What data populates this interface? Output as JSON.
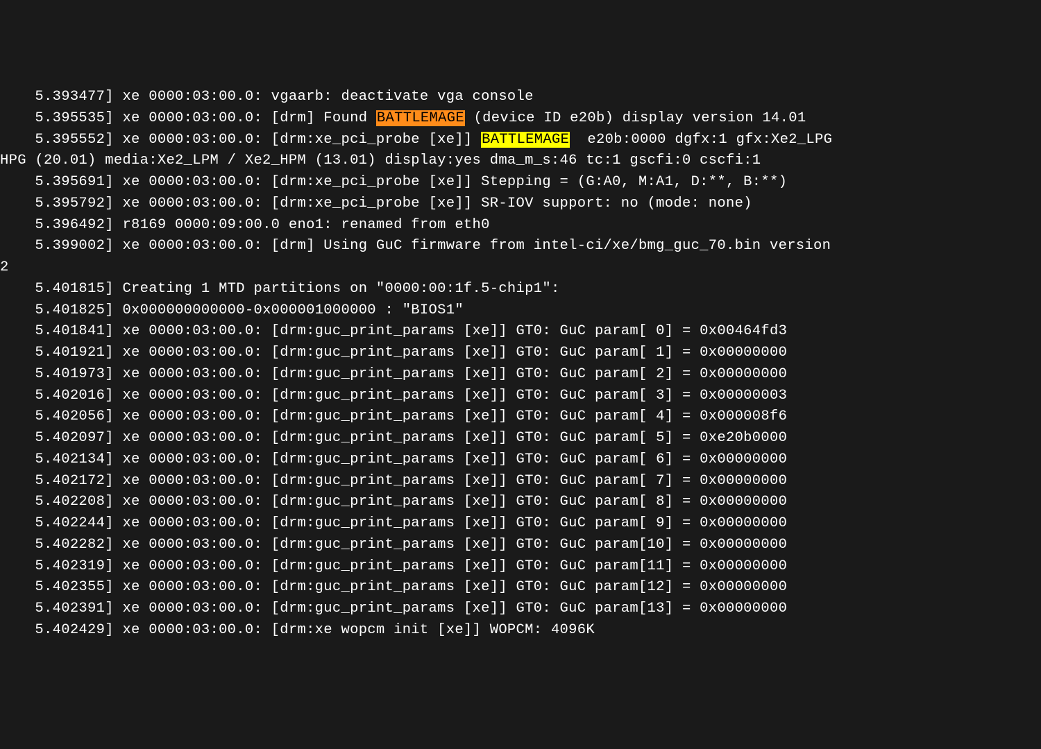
{
  "lines": [
    {
      "type": "text",
      "text": "    5.393477] xe 0000:03:00.0: vgaarb: deactivate vga console"
    },
    {
      "type": "highlighted1",
      "pre": "    5.395535] xe 0000:03:00.0: [drm] Found ",
      "hl": "BATTLEMAGE",
      "post": " (device ID e20b) display version 14.01"
    },
    {
      "type": "highlighted2",
      "pre": "    5.395552] xe 0000:03:00.0: [drm:xe_pci_probe [xe]] ",
      "hl": "BATTLEMAGE",
      "post": "  e20b:0000 dgfx:1 gfx:Xe2_LPG"
    },
    {
      "type": "text",
      "text": "HPG (20.01) media:Xe2_LPM / Xe2_HPM (13.01) display:yes dma_m_s:46 tc:1 gscfi:0 cscfi:1"
    },
    {
      "type": "text",
      "text": "    5.395691] xe 0000:03:00.0: [drm:xe_pci_probe [xe]] Stepping = (G:A0, M:A1, D:**, B:**)"
    },
    {
      "type": "text",
      "text": "    5.395792] xe 0000:03:00.0: [drm:xe_pci_probe [xe]] SR-IOV support: no (mode: none)"
    },
    {
      "type": "text",
      "text": "    5.396492] r8169 0000:09:00.0 eno1: renamed from eth0"
    },
    {
      "type": "text",
      "text": "    5.399002] xe 0000:03:00.0: [drm] Using GuC firmware from intel-ci/xe/bmg_guc_70.bin version"
    },
    {
      "type": "text",
      "text": "2"
    },
    {
      "type": "text",
      "text": "    5.401815] Creating 1 MTD partitions on \"0000:00:1f.5-chip1\":"
    },
    {
      "type": "text",
      "text": "    5.401825] 0x000000000000-0x000001000000 : \"BIOS1\""
    },
    {
      "type": "text",
      "text": "    5.401841] xe 0000:03:00.0: [drm:guc_print_params [xe]] GT0: GuC param[ 0] = 0x00464fd3"
    },
    {
      "type": "text",
      "text": "    5.401921] xe 0000:03:00.0: [drm:guc_print_params [xe]] GT0: GuC param[ 1] = 0x00000000"
    },
    {
      "type": "text",
      "text": "    5.401973] xe 0000:03:00.0: [drm:guc_print_params [xe]] GT0: GuC param[ 2] = 0x00000000"
    },
    {
      "type": "text",
      "text": "    5.402016] xe 0000:03:00.0: [drm:guc_print_params [xe]] GT0: GuC param[ 3] = 0x00000003"
    },
    {
      "type": "text",
      "text": "    5.402056] xe 0000:03:00.0: [drm:guc_print_params [xe]] GT0: GuC param[ 4] = 0x000008f6"
    },
    {
      "type": "text",
      "text": "    5.402097] xe 0000:03:00.0: [drm:guc_print_params [xe]] GT0: GuC param[ 5] = 0xe20b0000"
    },
    {
      "type": "text",
      "text": "    5.402134] xe 0000:03:00.0: [drm:guc_print_params [xe]] GT0: GuC param[ 6] = 0x00000000"
    },
    {
      "type": "text",
      "text": "    5.402172] xe 0000:03:00.0: [drm:guc_print_params [xe]] GT0: GuC param[ 7] = 0x00000000"
    },
    {
      "type": "text",
      "text": "    5.402208] xe 0000:03:00.0: [drm:guc_print_params [xe]] GT0: GuC param[ 8] = 0x00000000"
    },
    {
      "type": "text",
      "text": "    5.402244] xe 0000:03:00.0: [drm:guc_print_params [xe]] GT0: GuC param[ 9] = 0x00000000"
    },
    {
      "type": "text",
      "text": "    5.402282] xe 0000:03:00.0: [drm:guc_print_params [xe]] GT0: GuC param[10] = 0x00000000"
    },
    {
      "type": "text",
      "text": "    5.402319] xe 0000:03:00.0: [drm:guc_print_params [xe]] GT0: GuC param[11] = 0x00000000"
    },
    {
      "type": "text",
      "text": "    5.402355] xe 0000:03:00.0: [drm:guc_print_params [xe]] GT0: GuC param[12] = 0x00000000"
    },
    {
      "type": "text",
      "text": "    5.402391] xe 0000:03:00.0: [drm:guc_print_params [xe]] GT0: GuC param[13] = 0x00000000"
    },
    {
      "type": "text",
      "text": "    5.402429] xe 0000:03:00.0: [drm:xe wopcm init [xe]] WOPCM: 4096K"
    }
  ]
}
